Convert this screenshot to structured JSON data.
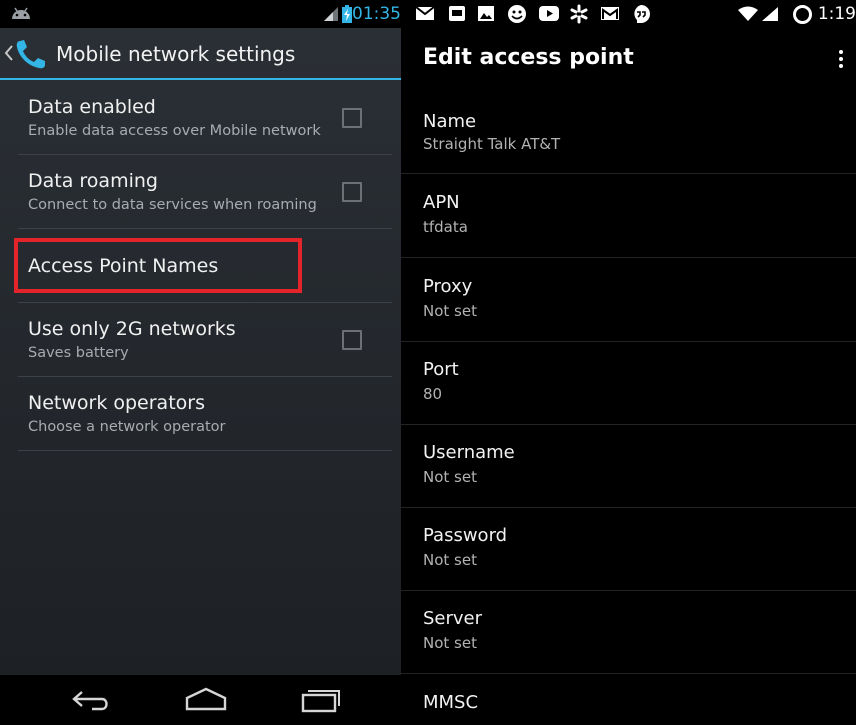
{
  "left": {
    "status_time": "01:35",
    "title": "Mobile network settings",
    "settings": [
      {
        "title": "Data enabled",
        "subtitle": "Enable data access over Mobile network"
      },
      {
        "title": "Data roaming",
        "subtitle": "Connect to data services when roaming"
      },
      {
        "title": "Access Point Names",
        "subtitle": ""
      },
      {
        "title": "Use only 2G networks",
        "subtitle": "Saves battery"
      },
      {
        "title": "Network operators",
        "subtitle": "Choose a network operator"
      }
    ],
    "accent_color": "#33b5e5",
    "highlight_color": "#e3242b"
  },
  "right": {
    "status_time": "1:19",
    "title": "Edit access point",
    "fields": [
      {
        "label": "Name",
        "value": "Straight Talk AT&T"
      },
      {
        "label": "APN",
        "value": "tfdata"
      },
      {
        "label": "Proxy",
        "value": "Not set"
      },
      {
        "label": "Port",
        "value": "80"
      },
      {
        "label": "Username",
        "value": "Not set"
      },
      {
        "label": "Password",
        "value": "Not set"
      },
      {
        "label": "Server",
        "value": "Not set"
      },
      {
        "label": "MMSC",
        "value": ""
      }
    ]
  }
}
